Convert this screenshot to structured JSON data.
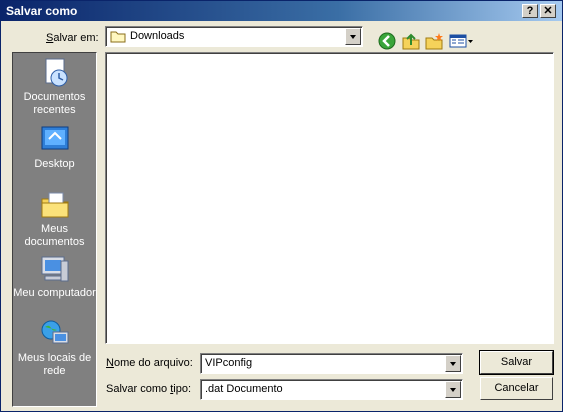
{
  "window": {
    "title": "Salvar como",
    "help_label": "?",
    "close_label": "✕"
  },
  "save_in": {
    "label_prefix": "S",
    "label_rest": "alvar em:",
    "value": "Downloads"
  },
  "toolbar": {
    "icons": [
      "back-icon",
      "up-folder-icon",
      "new-folder-icon",
      "view-menu-icon"
    ]
  },
  "places": {
    "items": [
      {
        "id": "recent",
        "label": "Documentos recentes",
        "icon": "recent-documents-icon"
      },
      {
        "id": "desktop",
        "label": "Desktop",
        "icon": "desktop-icon"
      },
      {
        "id": "my-documents",
        "label": "Meus documentos",
        "icon": "my-documents-icon"
      },
      {
        "id": "my-computer",
        "label": "Meu computador",
        "icon": "my-computer-icon"
      },
      {
        "id": "network",
        "label": "Meus locais de rede",
        "icon": "network-places-icon"
      }
    ]
  },
  "file_name": {
    "label_prefix": "N",
    "label_rest": "ome do arquivo:",
    "value": "VIPconfig"
  },
  "file_type": {
    "label_before": "Salvar como ",
    "label_prefix": "t",
    "label_rest": "ipo:",
    "value": ".dat Documento"
  },
  "buttons": {
    "save": "Salvar",
    "cancel": "Cancelar"
  },
  "colors": {
    "title_start": "#0a246a",
    "title_end": "#a6caf0",
    "places_bg": "#808080",
    "dialog_bg": "#ece9d8"
  }
}
